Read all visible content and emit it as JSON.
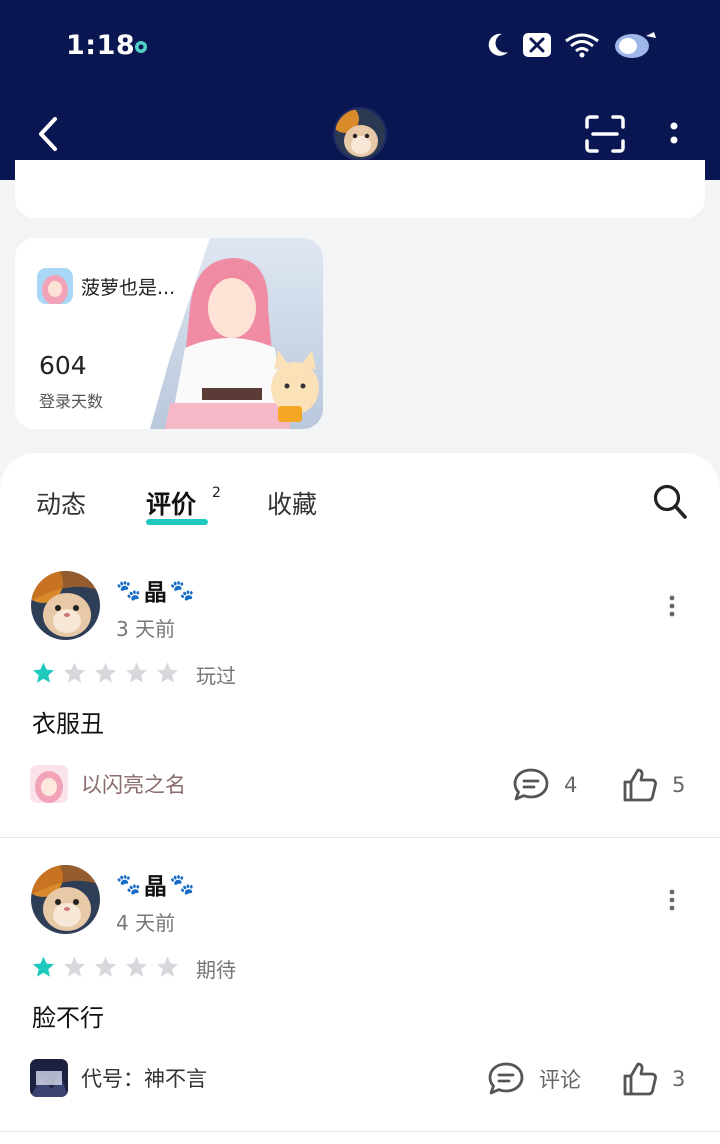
{
  "status_bar": {
    "time": "1:18",
    "icons": [
      "app-notification-icon",
      "moon-icon",
      "no-signal-icon",
      "wifi-icon",
      "battery-icon"
    ]
  },
  "header": {
    "back_icon": "chevron-left-icon",
    "avatar": "hamster-avatar",
    "scan_icon": "scan-icon",
    "more_icon": "vertical-dots-icon",
    "background_color": "#0a1652"
  },
  "game_card": {
    "game_name": "菠萝也是...",
    "login_days": "604",
    "login_label": "登录天数"
  },
  "tabs": {
    "items": [
      {
        "label": "动态"
      },
      {
        "label": "评价",
        "badge": "2"
      },
      {
        "label": "收藏"
      }
    ],
    "active_index": 1,
    "accent_color": "#1ec9bd"
  },
  "reviews": [
    {
      "username": "晶",
      "time": "3 天前",
      "rating": 1,
      "max_rating": 5,
      "state": "玩过",
      "content": "衣服丑",
      "game_label": "以闪亮之名",
      "comments": "4",
      "likes": "5"
    },
    {
      "username": "晶",
      "time": "4 天前",
      "rating": 1,
      "max_rating": 5,
      "state": "期待",
      "content": "脸不行",
      "game_label": "代号：神不言",
      "comments": "评论",
      "likes": "3"
    }
  ],
  "colors": {
    "star_filled": "#1ec9bd",
    "star_empty": "#d6d8dc",
    "game_chip_text": "#8a6b6b"
  }
}
